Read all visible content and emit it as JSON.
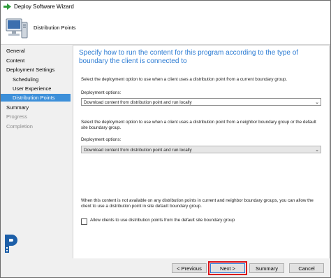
{
  "window": {
    "title": "Deploy Software Wizard"
  },
  "header": {
    "title": "Distribution Points"
  },
  "sidebar": {
    "items": [
      {
        "label": "General",
        "state": "normal"
      },
      {
        "label": "Content",
        "state": "normal"
      },
      {
        "label": "Deployment Settings",
        "state": "normal"
      },
      {
        "label": "Scheduling",
        "state": "normal"
      },
      {
        "label": "User Experience",
        "state": "normal"
      },
      {
        "label": "Distribution Points",
        "state": "active"
      },
      {
        "label": "Summary",
        "state": "normal"
      },
      {
        "label": "Progress",
        "state": "disabled"
      },
      {
        "label": "Completion",
        "state": "disabled"
      }
    ]
  },
  "main": {
    "heading": "Specify how to run the content for this program according to the type of boundary the client is connected to",
    "current_group": {
      "description": "Select the deployment option to use when a client uses a distribution point from a current boundary group.",
      "options_label": "Deployment options:",
      "selected": "Download content from distribution point and run locally"
    },
    "neighbor_group": {
      "description": "Select the deployment option to use when a client uses a distribution point from a neighbor boundary group or the default site boundary group.",
      "options_label": "Deployment options:",
      "selected": "Download content from distribution point and run locally"
    },
    "fallback_note": "When this content is not available on any distribution points in current and neighbor boundary groups, you can allow the client to use a distribution point in site default boundary group.",
    "fallback_checkbox": {
      "label": "Allow clients to use distribution points from the default site boundary group",
      "checked": false
    }
  },
  "footer": {
    "previous": "< Previous",
    "next": "Next >",
    "summary": "Summary",
    "cancel": "Cancel"
  },
  "colors": {
    "accent": "#2b7bd3",
    "nav_active": "#3c8fd9",
    "highlight": "#d9121a"
  }
}
